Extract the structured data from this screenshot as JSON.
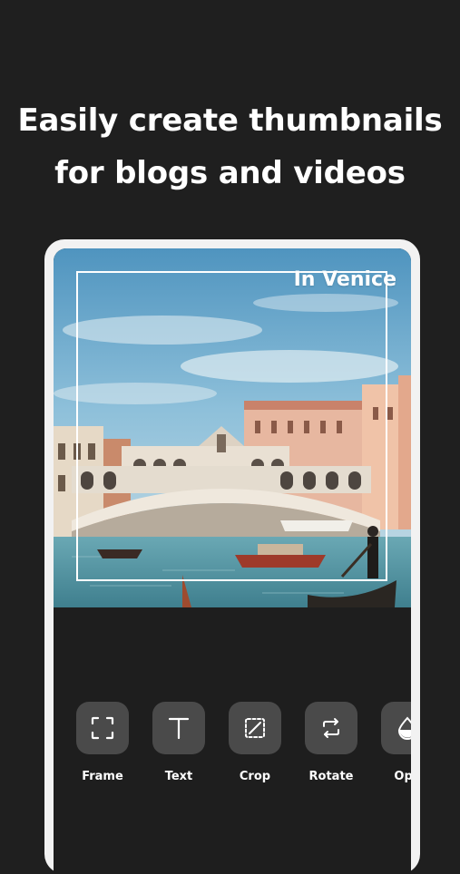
{
  "headline": {
    "line1": "Easily create thumbnails",
    "line2": "for blogs and videos"
  },
  "editor": {
    "overlay_text": "In Venice",
    "image_subject": "Rialto Bridge, Venice"
  },
  "toolbar": {
    "items": [
      {
        "label": "Frame",
        "icon": "frame-icon"
      },
      {
        "label": "Text",
        "icon": "text-icon"
      },
      {
        "label": "Crop",
        "icon": "crop-icon"
      },
      {
        "label": "Rotate",
        "icon": "rotate-icon"
      },
      {
        "label": "Opa",
        "icon": "opacity-icon"
      }
    ]
  },
  "colors": {
    "background": "#1f1f1f",
    "phone_frame": "#f2f2f2",
    "tool_button": "#4a4a4a",
    "text": "#ffffff"
  }
}
